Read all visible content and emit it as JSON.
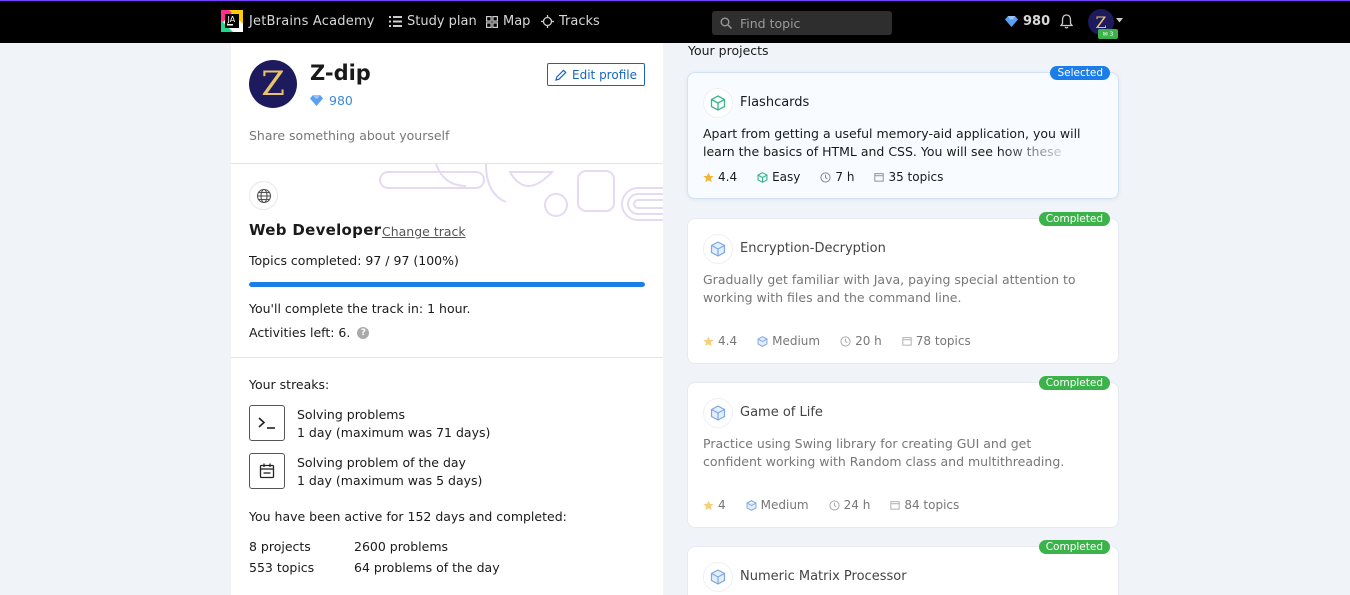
{
  "nav": {
    "brand": "JetBrains Academy",
    "study_plan": "Study plan",
    "map": "Map",
    "tracks": "Tracks",
    "search_placeholder": "Find topic",
    "gems": "980"
  },
  "profile": {
    "avatar_letter": "Z",
    "username": "Z-dip",
    "gems": "980",
    "edit_label": "Edit profile",
    "bio_placeholder": "Share something about yourself"
  },
  "track": {
    "title": "Web Developer",
    "change_label": "Change track",
    "topics_completed": "Topics completed: 97 / 97 (100%)",
    "progress_fraction": 1.0,
    "complete_in": "You'll complete the track in: 1 hour.",
    "activities_left": "Activities left: 6."
  },
  "streaks": {
    "title": "Your streaks:",
    "items": [
      {
        "name": "Solving problems",
        "value": "1 day (maximum was 71 days)",
        "icon": "terminal-icon"
      },
      {
        "name": "Solving problem of the day",
        "value": "1 day (maximum was 5 days)",
        "icon": "calendar-icon"
      }
    ]
  },
  "activity": {
    "summary": "You have been active for 152 days and completed:",
    "projects": "8 projects",
    "problems": "2600 problems",
    "topics": "553 topics",
    "potd": "64 problems of the day"
  },
  "projects": {
    "title": "Your projects",
    "cards": [
      {
        "status": "Selected",
        "name": "Flashcards",
        "desc": "Apart from getting a useful memory-aid application, you will learn the basics of HTML and CSS. You will see how these",
        "rating": "4.4",
        "level": "Easy",
        "hours": "7 h",
        "topics": "35 topics"
      },
      {
        "status": "Completed",
        "name": "Encryption-Decryption",
        "desc": "Gradually get familiar with Java, paying special attention to working with files and the command line.",
        "rating": "4.4",
        "level": "Medium",
        "hours": "20 h",
        "topics": "78 topics"
      },
      {
        "status": "Completed",
        "name": "Game of Life",
        "desc": "Practice using Swing library for creating GUI and get confident working with Random class and multithreading.",
        "rating": "4",
        "level": "Medium",
        "hours": "24 h",
        "topics": "84 topics"
      },
      {
        "status": "Completed",
        "name": "Numeric Matrix Processor",
        "desc": "",
        "rating": "",
        "level": "",
        "hours": "",
        "topics": ""
      }
    ]
  },
  "colors": {
    "accent": "#1d7de8",
    "completed": "#3bb34a",
    "gem": "#5b9ff0"
  }
}
